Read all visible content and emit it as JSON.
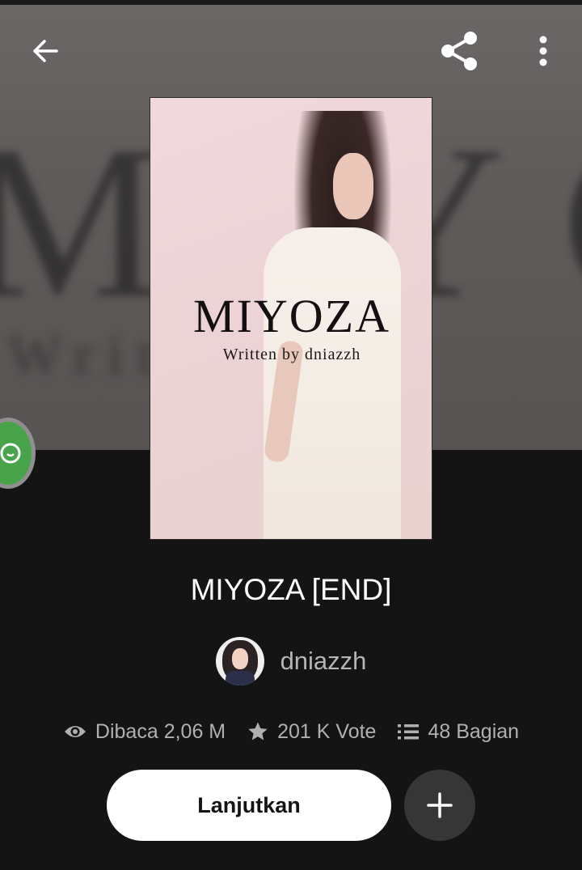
{
  "toolbar": {
    "back_icon": "arrow-left-icon",
    "share_icon": "share-icon",
    "more_icon": "more-vertical-icon"
  },
  "cover": {
    "title": "MIYOZA",
    "subtitle": "Written by dniazzh"
  },
  "story": {
    "title": "MIYOZA [END]",
    "author": "dniazzh"
  },
  "stats": {
    "reads": "Dibaca 2,06 M",
    "votes": "201 K Vote",
    "parts": "48 Bagian"
  },
  "actions": {
    "continue_label": "Lanjutkan",
    "add_icon": "plus-icon"
  },
  "colors": {
    "background": "#141414",
    "hero": "#5f5c5b",
    "floating_chip": "#49a34a",
    "button_primary": "#ffffff",
    "button_secondary": "#363636"
  }
}
